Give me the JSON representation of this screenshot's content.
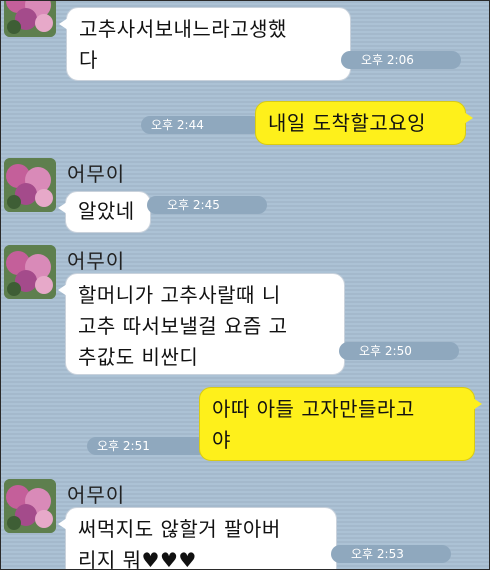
{
  "sender_name": "어무이",
  "messages": [
    {
      "text": "고추사서보내느라고생했\n다",
      "time": "오후 2:06"
    },
    {
      "text": "내일 도착할고요잉",
      "time": "오후 2:44"
    },
    {
      "text": "알았네",
      "time": "오후 2:45"
    },
    {
      "text": "할머니가 고추사랄때 니\n고추 따서보낼걸 요즘 고\n추값도 비싼디",
      "time": "오후 2:50"
    },
    {
      "text": "아따 아들 고자만들라고\n야",
      "time": "오후 2:51"
    },
    {
      "text": "써먹지도 않할거 팔아버\n리지 뭐♥♥♥",
      "time": "오후 2:53"
    }
  ],
  "colors": {
    "background": "#a9bfd3",
    "incoming_bubble": "#ffffff",
    "outgoing_bubble": "#fef01b",
    "timestamp_pill": "#8fa8be"
  },
  "icons": {
    "avatar": "hydrangea-photo"
  }
}
